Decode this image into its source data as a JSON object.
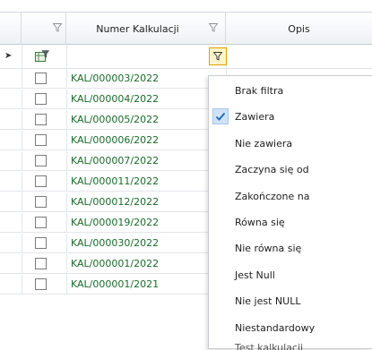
{
  "header": {
    "columns": [
      {
        "id": "checkbox",
        "title": ""
      },
      {
        "id": "numer",
        "title": "Numer Kalkulacji"
      },
      {
        "id": "opis",
        "title": "Opis"
      }
    ]
  },
  "rows": [
    {
      "code": "KAL/000003/2022"
    },
    {
      "code": "KAL/000004/2022"
    },
    {
      "code": "KAL/000005/2022"
    },
    {
      "code": "KAL/000006/2022"
    },
    {
      "code": "KAL/000007/2022"
    },
    {
      "code": "KAL/000011/2022"
    },
    {
      "code": "KAL/000012/2022"
    },
    {
      "code": "KAL/000019/2022"
    },
    {
      "code": "KAL/000030/2022"
    },
    {
      "code": "KAL/000001/2022"
    },
    {
      "code": "KAL/000001/2021"
    }
  ],
  "filter_menu": {
    "items": [
      {
        "label": "Brak filtra",
        "checked": false
      },
      {
        "label": "Zawiera",
        "checked": true
      },
      {
        "label": "Nie zawiera",
        "checked": false
      },
      {
        "label": "Zaczyna się od",
        "checked": false
      },
      {
        "label": "Zakończone na",
        "checked": false
      },
      {
        "label": "Równa się",
        "checked": false
      },
      {
        "label": "Nie równa się",
        "checked": false
      },
      {
        "label": "Jest Null",
        "checked": false
      },
      {
        "label": "Nie jest NULL",
        "checked": false
      },
      {
        "label": "Niestandardowy",
        "checked": false
      }
    ],
    "partial_row_text": "Test kalkulacji"
  },
  "colors": {
    "code_text": "#1a6b2a",
    "active_filter_border": "#e0a000",
    "check_highlight": "#cfe2f6"
  },
  "icons": {
    "header_filter": "funnel-icon",
    "row_indicator": "right-arrow-icon",
    "grid_filter": "grid-filter-icon",
    "active_filter": "funnel-icon",
    "check": "checkmark-icon"
  }
}
